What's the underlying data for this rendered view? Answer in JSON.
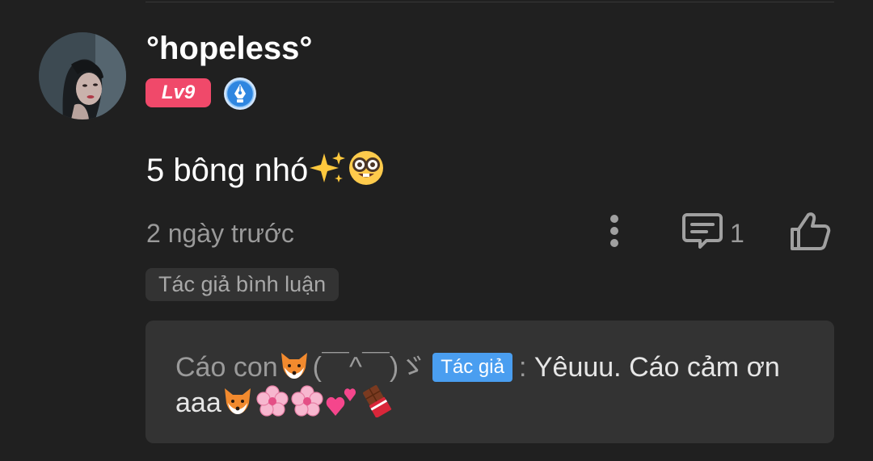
{
  "comment": {
    "username": "°hopeless°",
    "level_badge": "Lv9",
    "text": "5 bông nhó",
    "text_emojis": [
      "sparkles-emoji",
      "nerd-face-emoji"
    ],
    "timestamp": "2 ngày trước",
    "reply_count": "1",
    "author_comment_tag": "Tác giả bình luận"
  },
  "reply": {
    "author_name": "Cáo con",
    "author_suffix": "(￣^￣)ゞ",
    "author_label": "Tác giả",
    "separator": ":",
    "text_line1": "Yêuuu. Cáo cảm ơn",
    "text_line2": "aaa",
    "trailing_emojis": [
      "fox-emoji",
      "cherry-blossom-emoji",
      "cherry-blossom-emoji",
      "two-hearts-emoji",
      "chocolate-bar-emoji"
    ]
  },
  "colors": {
    "background": "#202020",
    "level_badge": "#f0496a",
    "author_label": "#4a9ef0",
    "card": "#333333",
    "muted_text": "#9a9a9a"
  }
}
